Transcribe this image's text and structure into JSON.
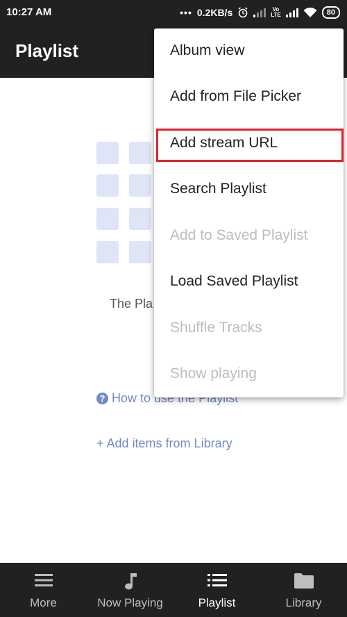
{
  "status_bar": {
    "time": "10:27 AM",
    "dots": "•••",
    "speed": "0.2KB/s",
    "volte": "Vo\nLTE",
    "battery": "80"
  },
  "app_bar": {
    "title": "Playlist"
  },
  "empty_state": {
    "message": "The Pla",
    "help_link": "How to use the Playlist",
    "add_link": "+ Add items from Library"
  },
  "menu": {
    "items": [
      {
        "label": "Album view",
        "enabled": true
      },
      {
        "label": "Add from File Picker",
        "enabled": true
      },
      {
        "label": "Add stream URL",
        "enabled": true,
        "highlighted": true
      },
      {
        "label": "Search Playlist",
        "enabled": true
      },
      {
        "label": "Add to Saved Playlist",
        "enabled": false
      },
      {
        "label": "Load Saved Playlist",
        "enabled": true
      },
      {
        "label": "Shuffle Tracks",
        "enabled": false
      },
      {
        "label": "Show playing",
        "enabled": false
      }
    ]
  },
  "bottom_nav": {
    "items": [
      {
        "label": "More",
        "icon": "hamburger-icon"
      },
      {
        "label": "Now Playing",
        "icon": "music-note-icon"
      },
      {
        "label": "Playlist",
        "icon": "list-icon",
        "active": true
      },
      {
        "label": "Library",
        "icon": "folder-icon"
      }
    ]
  },
  "colors": {
    "bar": "#212121",
    "link": "#6f8bc6",
    "highlight": "#e0202a",
    "illustration": "#dfe5f7"
  }
}
